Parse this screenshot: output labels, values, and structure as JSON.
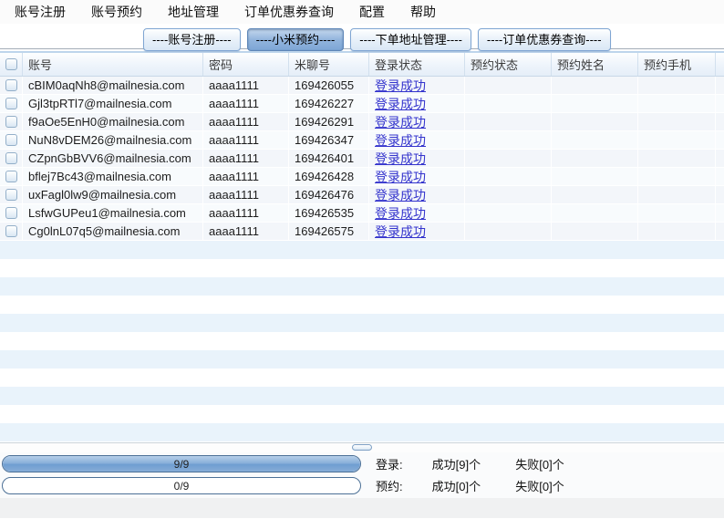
{
  "menu": {
    "items": [
      "账号注册",
      "账号预约",
      "地址管理",
      "订单优惠券查询",
      "配置",
      "帮助"
    ]
  },
  "tabs": [
    {
      "label": "----账号注册----",
      "selected": false
    },
    {
      "label": "----小米预约----",
      "selected": true
    },
    {
      "label": "----下单地址管理----",
      "selected": false
    },
    {
      "label": "----订单优惠券查询----",
      "selected": false
    }
  ],
  "table": {
    "columns": [
      "账号",
      "密码",
      "米聊号",
      "登录状态",
      "预约状态",
      "预约姓名",
      "预约手机"
    ],
    "rows": [
      {
        "account": "cBIM0aqNh8@mailnesia.com",
        "password": "aaaa1111",
        "miliao": "169426055",
        "login_status": "登录成功",
        "reserve_status": "",
        "reserve_name": "",
        "reserve_phone": ""
      },
      {
        "account": "Gjl3tpRTl7@mailnesia.com",
        "password": "aaaa1111",
        "miliao": "169426227",
        "login_status": "登录成功",
        "reserve_status": "",
        "reserve_name": "",
        "reserve_phone": ""
      },
      {
        "account": "f9aOe5EnH0@mailnesia.com",
        "password": "aaaa1111",
        "miliao": "169426291",
        "login_status": "登录成功",
        "reserve_status": "",
        "reserve_name": "",
        "reserve_phone": ""
      },
      {
        "account": "NuN8vDEM26@mailnesia.com",
        "password": "aaaa1111",
        "miliao": "169426347",
        "login_status": "登录成功",
        "reserve_status": "",
        "reserve_name": "",
        "reserve_phone": ""
      },
      {
        "account": "CZpnGbBVV6@mailnesia.com",
        "password": "aaaa1111",
        "miliao": "169426401",
        "login_status": "登录成功",
        "reserve_status": "",
        "reserve_name": "",
        "reserve_phone": ""
      },
      {
        "account": "bflej7Bc43@mailnesia.com",
        "password": "aaaa1111",
        "miliao": "169426428",
        "login_status": "登录成功",
        "reserve_status": "",
        "reserve_name": "",
        "reserve_phone": ""
      },
      {
        "account": "uxFagl0lw9@mailnesia.com",
        "password": "aaaa1111",
        "miliao": "169426476",
        "login_status": "登录成功",
        "reserve_status": "",
        "reserve_name": "",
        "reserve_phone": ""
      },
      {
        "account": "LsfwGUPeu1@mailnesia.com",
        "password": "aaaa1111",
        "miliao": "169426535",
        "login_status": "登录成功",
        "reserve_status": "",
        "reserve_name": "",
        "reserve_phone": ""
      },
      {
        "account": "Cg0lnL07q5@mailnesia.com",
        "password": "aaaa1111",
        "miliao": "169426575",
        "login_status": "登录成功",
        "reserve_status": "",
        "reserve_name": "",
        "reserve_phone": ""
      }
    ]
  },
  "progress": {
    "login": {
      "label": "9/9",
      "value": 9,
      "max": 9,
      "percent": 100
    },
    "reserve": {
      "label": "0/9",
      "value": 0,
      "max": 9,
      "percent": 0
    }
  },
  "status": {
    "login": {
      "label": "登录:",
      "success": "成功[9]个",
      "fail": "失败[0]个"
    },
    "reserve": {
      "label": "预约:",
      "success": "成功[0]个",
      "fail": "失败[0]个"
    }
  },
  "colors": {
    "link_blue": "#3434cd",
    "tab_selected_blue": "#7da6d6",
    "progress_fill_blue": "#7da7d9",
    "stripe_blue": "#e9f3fb"
  }
}
